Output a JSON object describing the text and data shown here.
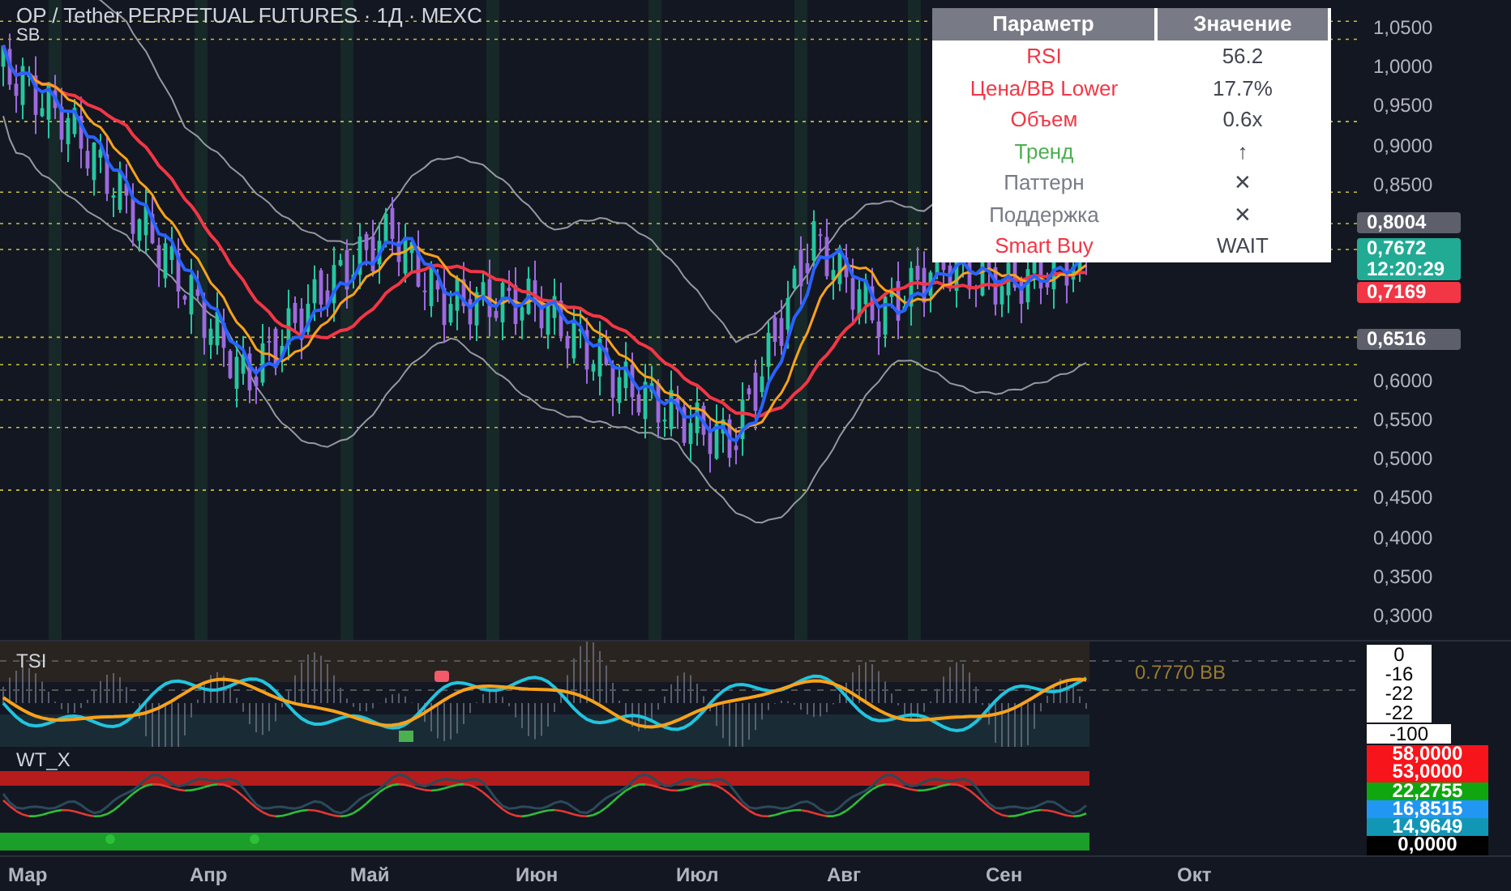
{
  "chart": {
    "title": "OP / Tether PERPETUAL FUTURES · 1Д · MEXC",
    "indicator": "SB",
    "price_axis": [
      "1,0500",
      "1,0000",
      "0,9500",
      "0,9000",
      "0,8500",
      "0,6000",
      "0,5500",
      "0,5000",
      "0,4500",
      "0,4000",
      "0,3500",
      "0,3000"
    ],
    "price_badges": [
      {
        "lines": [
          "0,8004"
        ],
        "color": "#5d606b"
      },
      {
        "lines": [
          "0,7672",
          "12:20:29"
        ],
        "color": "#22ab94"
      },
      {
        "lines": [
          "0,7169"
        ],
        "color": "#f23645"
      },
      {
        "lines": [
          "0,6516"
        ],
        "color": "#5d606b"
      }
    ],
    "table": {
      "columns": [
        "Параметр",
        "Значение"
      ],
      "rows": [
        {
          "parameter": "RSI",
          "value": "56.2",
          "color": "#f23645"
        },
        {
          "parameter": "Цена/BB Lower",
          "value": "17.7%",
          "color": "#f23645"
        },
        {
          "parameter": "Объем",
          "value": "0.6x",
          "color": "#f23645"
        },
        {
          "parameter": "Тренд",
          "value": "↑",
          "color": "#4caf50"
        },
        {
          "parameter": "Паттерн",
          "value": "✕",
          "color": "#787b86"
        },
        {
          "parameter": "Поддержка",
          "value": "✕",
          "color": "#787b86"
        },
        {
          "parameter": "Smart Buy",
          "value": "WAIT",
          "color": "#f23645"
        }
      ]
    }
  },
  "tsi_panel": {
    "label": "TSI",
    "note": "0.7770 BB",
    "scale": [
      "0",
      "-16",
      "-22",
      "-22"
    ],
    "bottom_label": "-100"
  },
  "wt_panel": {
    "label": "WT_X",
    "scale": [
      {
        "text": "58,0000",
        "color": "#f7141a"
      },
      {
        "text": "53,0000",
        "color": "#f7141a"
      },
      {
        "text": "22,2755",
        "color": "#10a610"
      },
      {
        "text": "16,8515",
        "color": "#2196f3"
      },
      {
        "text": "14,9649",
        "color": "#1197b5"
      },
      {
        "text": "0,0000",
        "color": "#000000"
      }
    ]
  },
  "time_axis": [
    {
      "label": "Мар"
    },
    {
      "label": "Апр"
    },
    {
      "label": "Май"
    },
    {
      "label": "Июн"
    },
    {
      "label": "Июл"
    },
    {
      "label": "Авг"
    },
    {
      "label": "Сен"
    },
    {
      "label": "Окт"
    }
  ]
}
